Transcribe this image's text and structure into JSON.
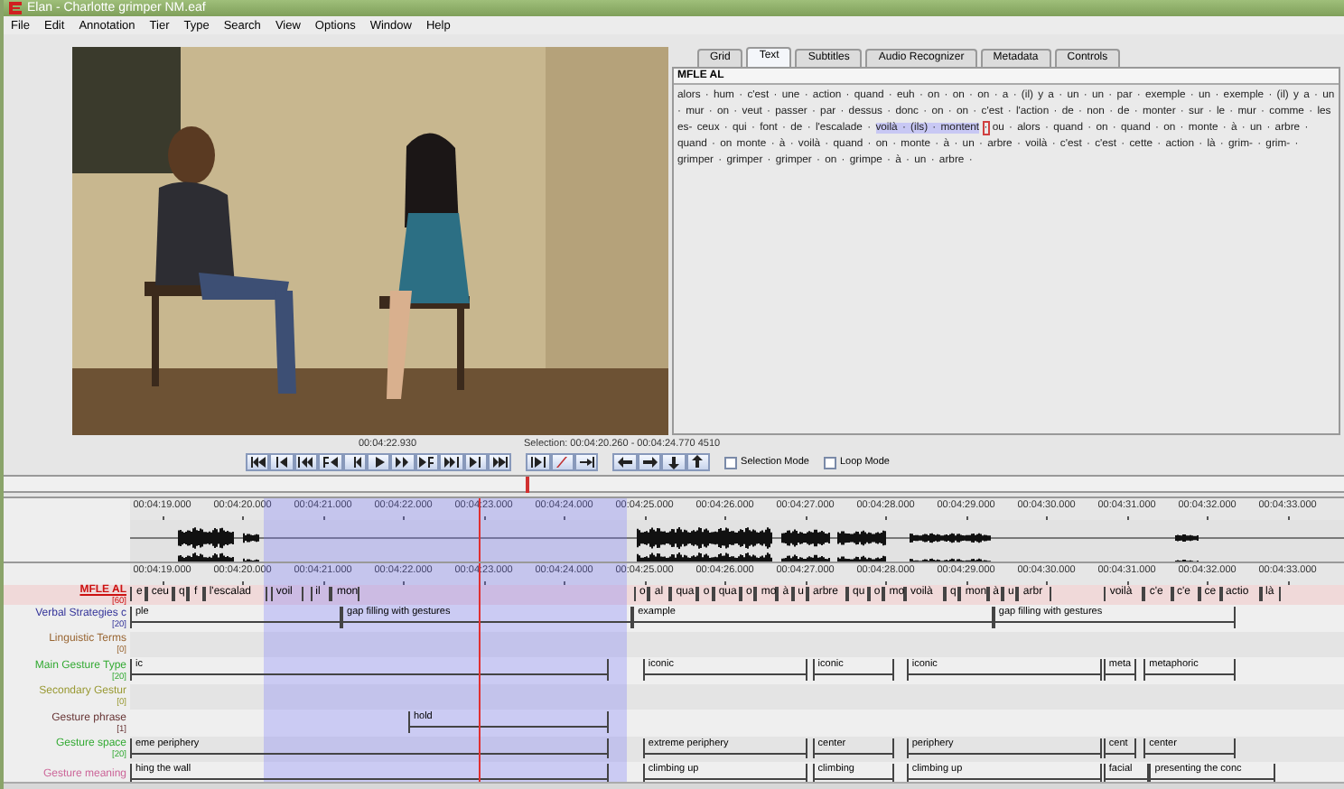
{
  "window": {
    "title": "Elan - Charlotte grimper NM.eaf"
  },
  "menu": [
    "File",
    "Edit",
    "Annotation",
    "Tier",
    "Type",
    "Search",
    "View",
    "Options",
    "Window",
    "Help"
  ],
  "tabs": [
    {
      "label": "Grid",
      "selected": false
    },
    {
      "label": "Text",
      "selected": true
    },
    {
      "label": "Subtitles",
      "selected": false
    },
    {
      "label": "Audio Recognizer",
      "selected": false
    },
    {
      "label": "Metadata",
      "selected": false
    },
    {
      "label": "Controls",
      "selected": false
    }
  ],
  "text_view": {
    "tier": "MFLE AL",
    "segments": [
      {
        "kind": "plain",
        "text": "alors · hum · c'est · une · action · quand · euh · on · on · on · a · (il) y a · un · un · par · exemple · un · exemple · (il) y a · un · mur · on · veut · passer · par · dessus · donc · on · on · c'est · l'action · de · non · de · monter · sur · le · mur · comme · les es- ceux · qui · font · de · l'escalade ·"
      },
      {
        "kind": "selected",
        "text": "voilà · (ils) · montent"
      },
      {
        "kind": "current",
        "text": "·"
      },
      {
        "kind": "plain",
        "text": "ou · alors · quand · on · quand · on · monte · à · un · arbre · quand · on monte · à · voilà · quand · on · monte · à · un · arbre · voilà · c'est · c'est · cette · action · là · grim- · grim- · grimper · grimper · grimper · on · grimpe · à · un · arbre ·"
      }
    ]
  },
  "player": {
    "time": "00:04:22.930",
    "selection": "Selection: 00:04:20.260 - 00:04:24.770  4510",
    "checkboxes": [
      {
        "label": "Selection Mode",
        "checked": false
      },
      {
        "label": "Loop Mode",
        "checked": false
      }
    ]
  },
  "slider": {
    "level": 0.39
  },
  "waveform_ruler": [
    "00:04:19.000",
    "00:04:20.000",
    "00:04:21.000",
    "00:04:22.000",
    "00:04:23.000",
    "00:04:24.000",
    "00:04:25.000",
    "00:04:26.000",
    "00:04:27.000",
    "00:04:28.000",
    "00:04:29.000",
    "00:04:30.000",
    "00:04:31.000",
    "00:04:32.000",
    "00:04:33.000"
  ],
  "annotation_ruler": [
    "00:04:19.000",
    "00:04:20.000",
    "00:04:21.000",
    "00:04:22.000",
    "00:04:23.000",
    "00:04:24.000",
    "00:04:25.000",
    "00:04:26.000",
    "00:04:27.000",
    "00:04:28.000",
    "00:04:29.000",
    "00:04:30.000",
    "00:04:31.000",
    "00:04:32.000",
    "00:04:33.000"
  ],
  "tiers": [
    {
      "name": "MFLE AL",
      "count": "[60]",
      "color": "#cc1111",
      "active": true,
      "annotations": [
        "e",
        "ceu",
        "q",
        "f",
        "l'escalad",
        "voil",
        "il",
        "mon",
        "o",
        "al",
        "qua",
        "o",
        "qua",
        "o",
        "mo",
        "à",
        "u",
        "arbre",
        "qu",
        "o",
        "mo",
        "voilà",
        "q",
        "mon",
        "à",
        "u",
        "arbr",
        "voilà",
        "c'e",
        "c'e",
        "ce",
        "actio",
        "là"
      ]
    },
    {
      "name": "Verbal Strategies c",
      "count": "[20]",
      "color": "#333399",
      "active": false,
      "annotations": [
        "ple",
        "gap filling with gestures",
        "example",
        "gap filling with gestures"
      ]
    },
    {
      "name": "Linguistic Terms",
      "count": "[0]",
      "color": "#996633",
      "active": false
    },
    {
      "name": "Main Gesture Type",
      "count": "[20]",
      "color": "#33aa33",
      "active": false,
      "annotations": [
        "ic",
        "iconic",
        "iconic",
        "iconic",
        "meta",
        "metaphoric"
      ]
    },
    {
      "name": "Secondary Gestur",
      "count": "[0]",
      "color": "#999933",
      "active": false
    },
    {
      "name": "Gesture phrase",
      "count": "[1]",
      "color": "#663333",
      "active": false,
      "annotations": [
        "hold"
      ]
    },
    {
      "name": "Gesture space",
      "count": "[20]",
      "color": "#33aa33",
      "active": false,
      "annotations": [
        "eme periphery",
        "extreme periphery",
        "center",
        "periphery",
        "cent",
        "center"
      ]
    },
    {
      "name": "Gesture meaning",
      "color": "#cc6699",
      "active": false,
      "annotations": [
        "hing the wall",
        "climbing up",
        "climbing",
        "climbing up",
        "facial",
        "presenting the conc"
      ]
    }
  ]
}
